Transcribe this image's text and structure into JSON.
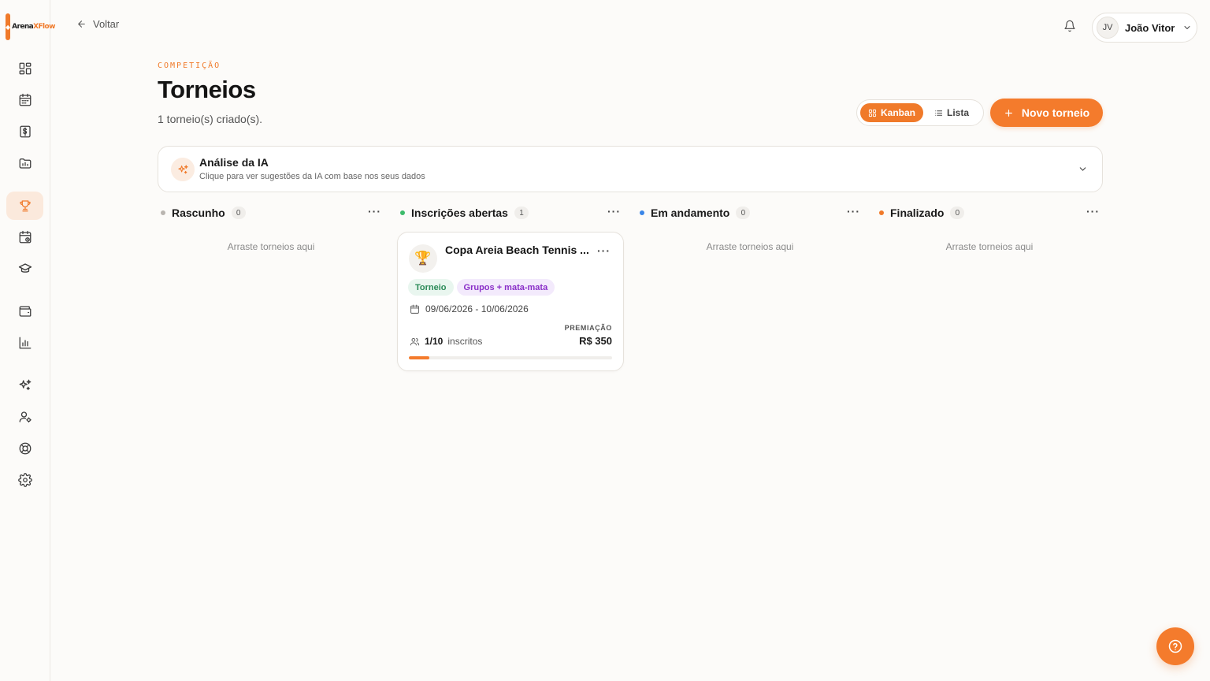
{
  "brand": {
    "name_part1": "Arena",
    "name_part2": "XFlow",
    "accent": "#f07a2a"
  },
  "sidebar": {
    "items": [
      {
        "icon": "dashboard-icon"
      },
      {
        "icon": "calendar-icon"
      },
      {
        "icon": "dollar-icon"
      },
      {
        "icon": "folder-chart-icon"
      },
      {
        "icon": "trophy-icon",
        "active": true
      },
      {
        "icon": "calendar-check-icon"
      },
      {
        "icon": "graduation-cap-icon"
      },
      {
        "icon": "wallet-icon"
      },
      {
        "icon": "bar-chart-icon"
      },
      {
        "icon": "sparkles-icon"
      },
      {
        "icon": "user-settings-icon"
      },
      {
        "icon": "lifebuoy-icon"
      },
      {
        "icon": "gear-icon"
      }
    ]
  },
  "topbar": {
    "back_label": "Voltar",
    "user": {
      "initials": "JV",
      "name": "João Vitor"
    }
  },
  "header": {
    "eyebrow": "COMPETIÇÃO",
    "title": "Torneios",
    "subtitle": "1 torneio(s) criado(s).",
    "view_kanban": "Kanban",
    "view_list": "Lista",
    "new_button": "Novo torneio"
  },
  "ai_panel": {
    "title": "Análise da IA",
    "subtitle": "Clique para ver sugestões da IA com base nos seus dados"
  },
  "columns": [
    {
      "title": "Rascunho",
      "count": "0",
      "dot_color": "#b9b5b0",
      "empty_text": "Arraste torneios aqui"
    },
    {
      "title": "Inscrições abertas",
      "count": "1",
      "dot_color": "#3dbb6b",
      "empty_text": ""
    },
    {
      "title": "Em andamento",
      "count": "0",
      "dot_color": "#3a86e8",
      "empty_text": "Arraste torneios aqui"
    },
    {
      "title": "Finalizado",
      "count": "0",
      "dot_color": "#f07a2a",
      "empty_text": "Arraste torneios aqui"
    }
  ],
  "card": {
    "title": "Copa Areia Beach Tennis ...",
    "icon": "🏆",
    "tags": [
      "Torneio",
      "Grupos + mata-mata"
    ],
    "dates": "09/06/2026 - 10/06/2026",
    "enrolled": "1/10",
    "enrolled_label": "inscritos",
    "prize_label": "PREMIAÇÃO",
    "prize_value": "R$ 350",
    "progress_fraction": 0.1
  }
}
